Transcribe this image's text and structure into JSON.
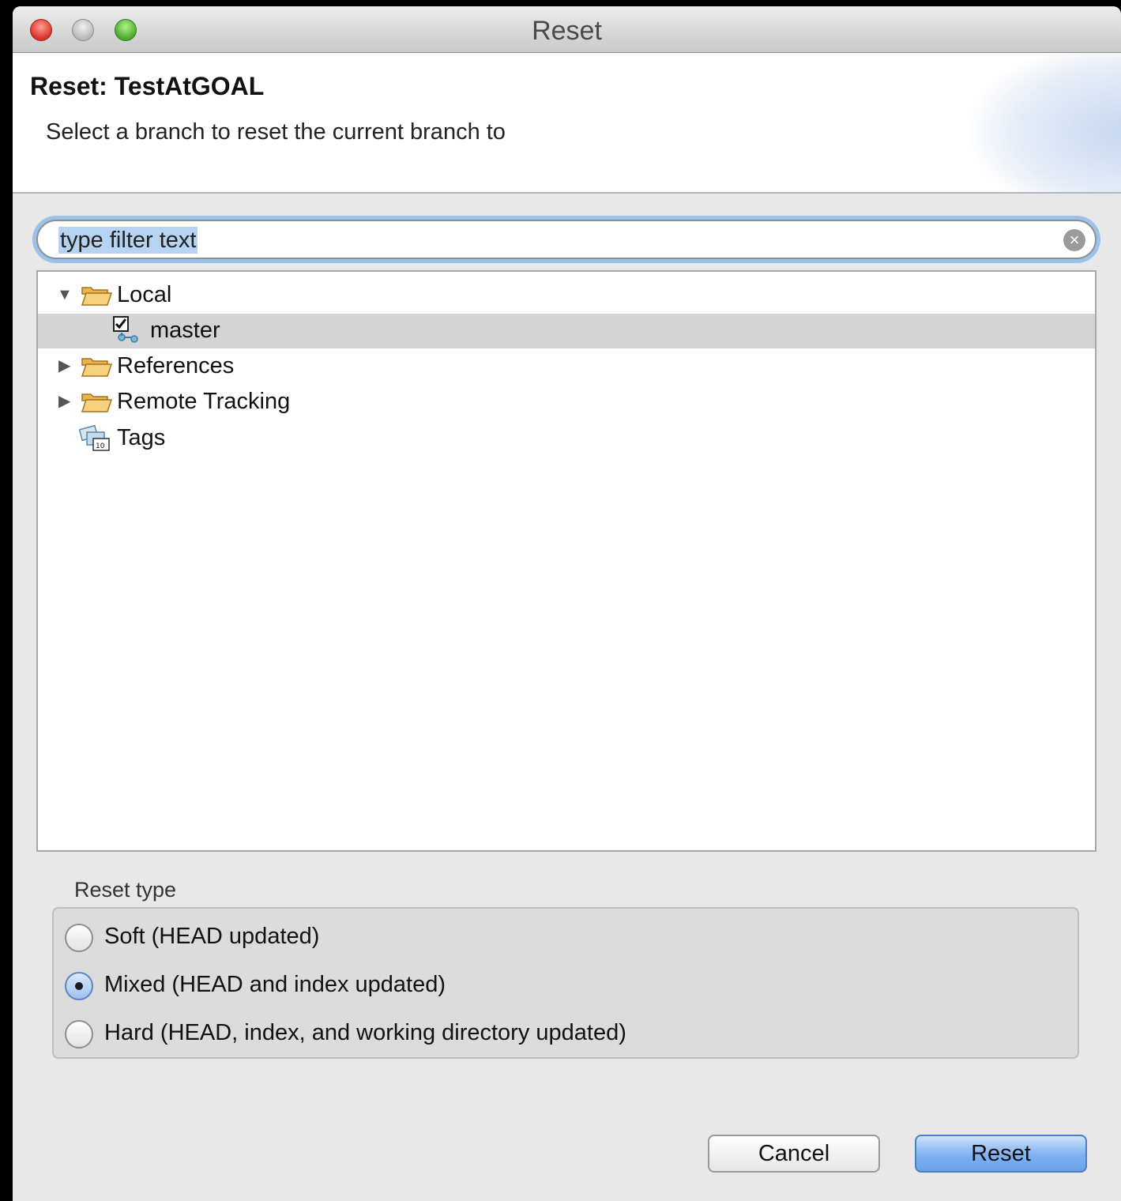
{
  "window": {
    "title": "Reset"
  },
  "header": {
    "title": "Reset: TestAtGOAL",
    "message": "Select a branch to reset the current branch to"
  },
  "filter": {
    "value": "type filter text"
  },
  "tree": {
    "local": "Local",
    "master": "master",
    "references": "References",
    "remote_tracking": "Remote Tracking",
    "tags": "Tags"
  },
  "reset_type": {
    "label": "Reset type",
    "options": [
      {
        "label": "Soft (HEAD updated)",
        "checked": false
      },
      {
        "label": "Mixed (HEAD and index updated)",
        "checked": true
      },
      {
        "label": "Hard (HEAD, index, and working directory updated)",
        "checked": false
      }
    ]
  },
  "buttons": {
    "cancel": "Cancel",
    "reset": "Reset"
  },
  "colors": {
    "selection": "#d4d4d4",
    "accent": "#6aa2ea",
    "focus": "#9cc2ea"
  }
}
